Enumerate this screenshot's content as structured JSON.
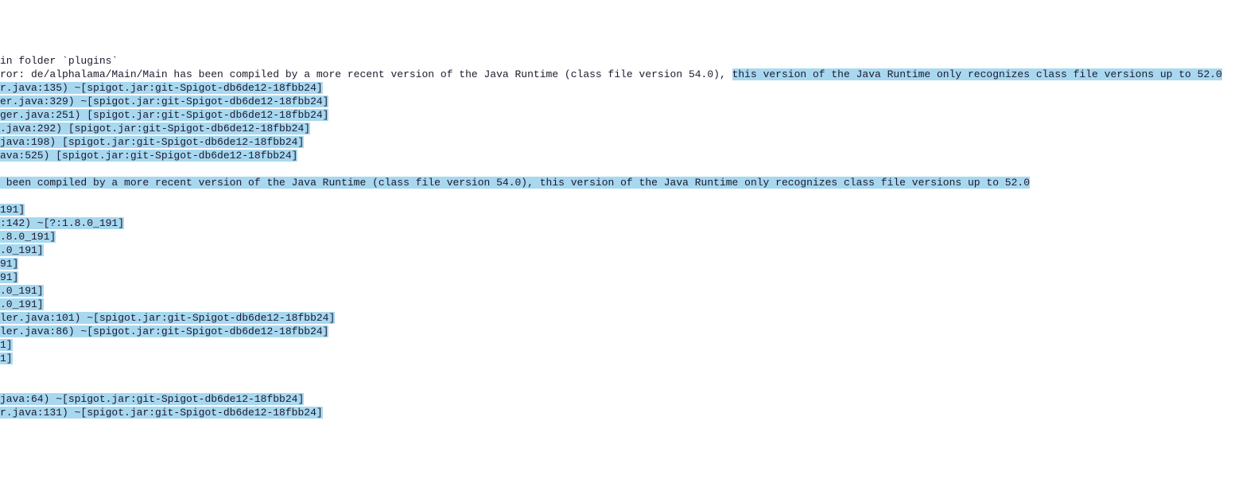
{
  "log": {
    "lines": [
      {
        "segments": [
          {
            "text": "in folder `plugins`",
            "highlighted": false
          }
        ]
      },
      {
        "segments": [
          {
            "text": "ror: de/alphalama/Main/Main has been compiled by a more recent version of the Java Runtime (class file version 54.0), ",
            "highlighted": false
          },
          {
            "text": "this version of the Java Runtime only recognizes class file versions up to 52.0",
            "highlighted": true
          }
        ]
      },
      {
        "segments": [
          {
            "text": "r.java:135) ~[spigot.jar:git-Spigot-db6de12-18fbb24]",
            "highlighted": true
          }
        ]
      },
      {
        "segments": [
          {
            "text": "er.java:329) ~[spigot.jar:git-Spigot-db6de12-18fbb24]",
            "highlighted": true
          }
        ]
      },
      {
        "segments": [
          {
            "text": "ger.java:251) [spigot.jar:git-Spigot-db6de12-18fbb24]",
            "highlighted": true
          }
        ]
      },
      {
        "segments": [
          {
            "text": ".java:292) [spigot.jar:git-Spigot-db6de12-18fbb24]",
            "highlighted": true
          }
        ]
      },
      {
        "segments": [
          {
            "text": "java:198) [spigot.jar:git-Spigot-db6de12-18fbb24]",
            "highlighted": true
          }
        ]
      },
      {
        "segments": [
          {
            "text": "ava:525) [spigot.jar:git-Spigot-db6de12-18fbb24]",
            "highlighted": true
          }
        ]
      },
      {
        "segments": [
          {
            "text": "",
            "highlighted": false
          }
        ]
      },
      {
        "segments": [
          {
            "text": " been compiled by a more recent version of the Java Runtime (class file version 54.0), this version of the Java Runtime only recognizes class file versions up to 52.0",
            "highlighted": true
          }
        ]
      },
      {
        "segments": [
          {
            "text": "",
            "highlighted": false
          }
        ]
      },
      {
        "segments": [
          {
            "text": "191]",
            "highlighted": true
          }
        ]
      },
      {
        "segments": [
          {
            "text": ":142) ~[?:1.8.0_191]",
            "highlighted": true
          }
        ]
      },
      {
        "segments": [
          {
            "text": ".8.0_191]",
            "highlighted": true
          }
        ]
      },
      {
        "segments": [
          {
            "text": ".0_191]",
            "highlighted": true
          }
        ]
      },
      {
        "segments": [
          {
            "text": "91]",
            "highlighted": true
          }
        ]
      },
      {
        "segments": [
          {
            "text": "91]",
            "highlighted": true
          }
        ]
      },
      {
        "segments": [
          {
            "text": ".0_191]",
            "highlighted": true
          }
        ]
      },
      {
        "segments": [
          {
            "text": ".0_191]",
            "highlighted": true
          }
        ]
      },
      {
        "segments": [
          {
            "text": "ler.java:101) ~[spigot.jar:git-Spigot-db6de12-18fbb24]",
            "highlighted": true
          }
        ]
      },
      {
        "segments": [
          {
            "text": "ler.java:86) ~[spigot.jar:git-Spigot-db6de12-18fbb24]",
            "highlighted": true
          }
        ]
      },
      {
        "segments": [
          {
            "text": "1]",
            "highlighted": true
          }
        ]
      },
      {
        "segments": [
          {
            "text": "1]",
            "highlighted": true
          }
        ]
      },
      {
        "segments": [
          {
            "text": "",
            "highlighted": false
          }
        ]
      },
      {
        "segments": [
          {
            "text": "",
            "highlighted": false
          }
        ]
      },
      {
        "segments": [
          {
            "text": "java:64) ~[spigot.jar:git-Spigot-db6de12-18fbb24]",
            "highlighted": true
          }
        ]
      },
      {
        "segments": [
          {
            "text": "r.java:131) ~[spigot.jar:git-Spigot-db6de12-18fbb24]",
            "highlighted": true
          }
        ]
      }
    ]
  }
}
